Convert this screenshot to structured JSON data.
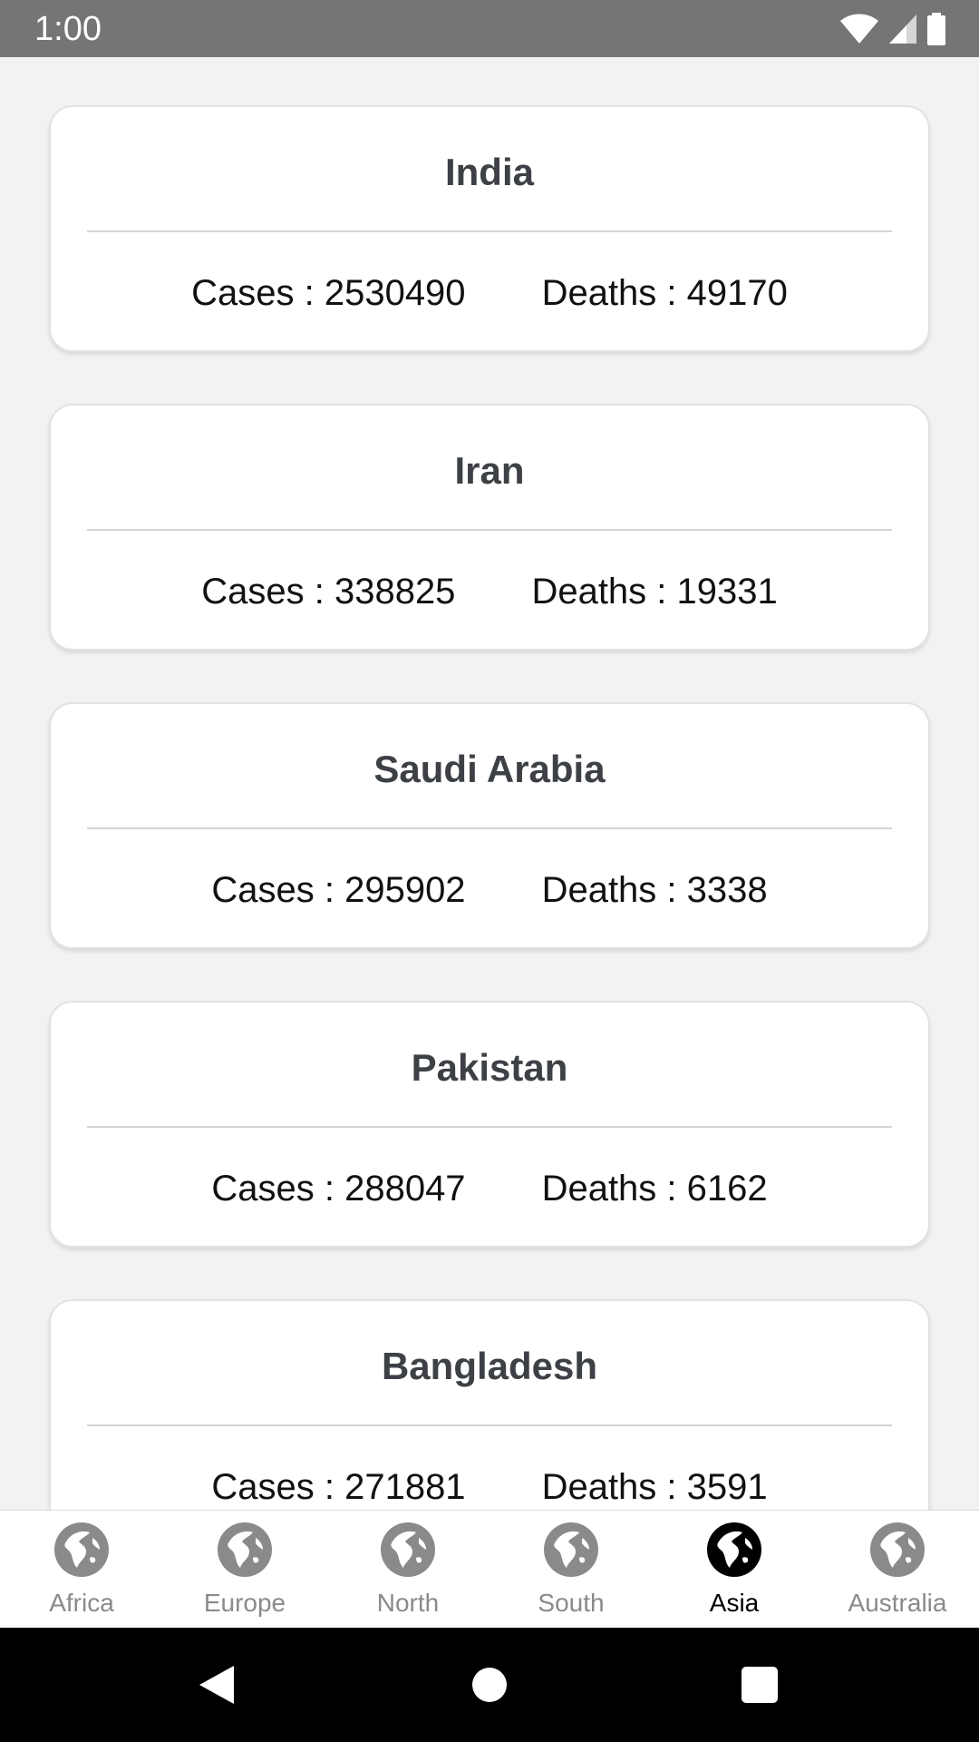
{
  "status_bar": {
    "time": "1:00",
    "icons": [
      "wifi-icon",
      "cellular-signal-icon",
      "battery-icon"
    ]
  },
  "labels": {
    "cases_prefix": "Cases : ",
    "deaths_prefix": "Deaths : "
  },
  "countries": [
    {
      "name": "India",
      "cases": "2530490",
      "deaths": "49170"
    },
    {
      "name": "Iran",
      "cases": "338825",
      "deaths": "19331"
    },
    {
      "name": "Saudi Arabia",
      "cases": "295902",
      "deaths": "3338"
    },
    {
      "name": "Pakistan",
      "cases": "288047",
      "deaths": "6162"
    },
    {
      "name": "Bangladesh",
      "cases": "271881",
      "deaths": "3591"
    }
  ],
  "bottom_nav": {
    "active": "Asia",
    "icon": "globe-icon",
    "items": [
      {
        "label": "Africa"
      },
      {
        "label": "Europe"
      },
      {
        "label": "North"
      },
      {
        "label": "South"
      },
      {
        "label": "Asia"
      },
      {
        "label": "Australia"
      }
    ]
  },
  "system_nav": {
    "buttons": [
      "back-icon",
      "home-icon",
      "recents-icon"
    ]
  },
  "colors": {
    "status_bar": "#757575",
    "background": "#f2f2f2",
    "card": "#ffffff",
    "title_text": "#3d4146",
    "nav_inactive": "#8a8a8a",
    "nav_active": "#000000",
    "system_nav": "#000000"
  }
}
